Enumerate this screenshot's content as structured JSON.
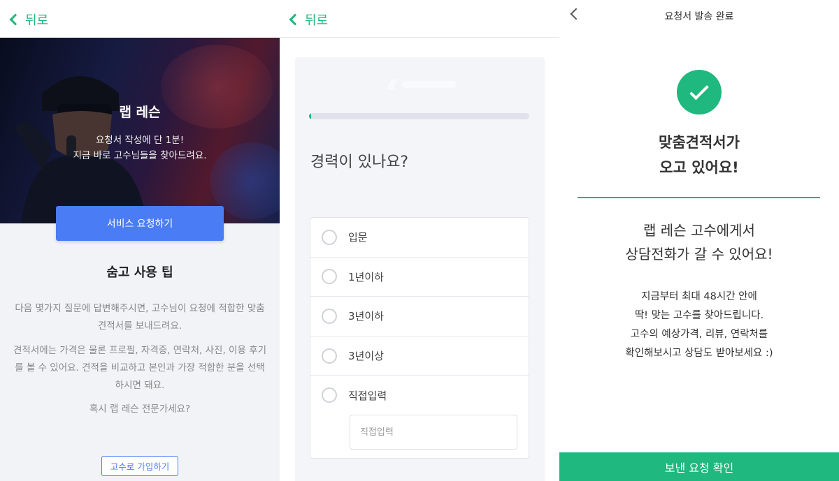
{
  "colors": {
    "accent_green": "#1fb87e",
    "accent_blue": "#4a7cf5"
  },
  "screen1": {
    "back_label": "뒤로",
    "hero_title": "랩 레슨",
    "hero_subtitle_line1": "요청서 작성에 단 1분!",
    "hero_subtitle_line2": "지금 바로 고수님들을 찾아드려요.",
    "request_button": "서비스 요청하기",
    "tips_title": "숨고 사용 팁",
    "tips_paragraph1": "다음 몇가지 질문에 답변해주시면, 고수님이 요청에 적합한 맞춤 견적서를 보내드려요.",
    "tips_paragraph2": "견적서에는 가격은 물론 프로필, 자격증, 연락처, 사진, 이용 후기를 볼 수 있어요. 견적을 비교하고 본인과 가장 적합한 분을 선택하시면 돼요.",
    "tips_paragraph3": "혹시 랩 레슨 전문가세요?",
    "join_button": "고수로 가입하기"
  },
  "screen2": {
    "back_label": "뒤로",
    "progress_fraction": 0.01,
    "question": "경력이 있나요?",
    "options": [
      {
        "label": "입문"
      },
      {
        "label": "1년이하"
      },
      {
        "label": "3년이하"
      },
      {
        "label": "3년이상"
      },
      {
        "label": "직접입력"
      }
    ],
    "direct_input_placeholder": "직접입력"
  },
  "screen3": {
    "title": "요청서 발송 완료",
    "headline_line1": "맞춤견적서가",
    "headline_line2": "오고 있어요!",
    "message_line1": "랩 레슨 고수에게서",
    "message_line2": "상담전화가 갈 수 있어요!",
    "desc_line1": "지금부터 최대 48시간 안에",
    "desc_line2": "딱! 맞는 고수를 찾아드립니다.",
    "desc_line3": "고수의 예상가격, 리뷰, 연락처를",
    "desc_line4": "확인해보시고 상담도 받아보세요 :)",
    "confirm_button": "보낸 요청 확인"
  }
}
